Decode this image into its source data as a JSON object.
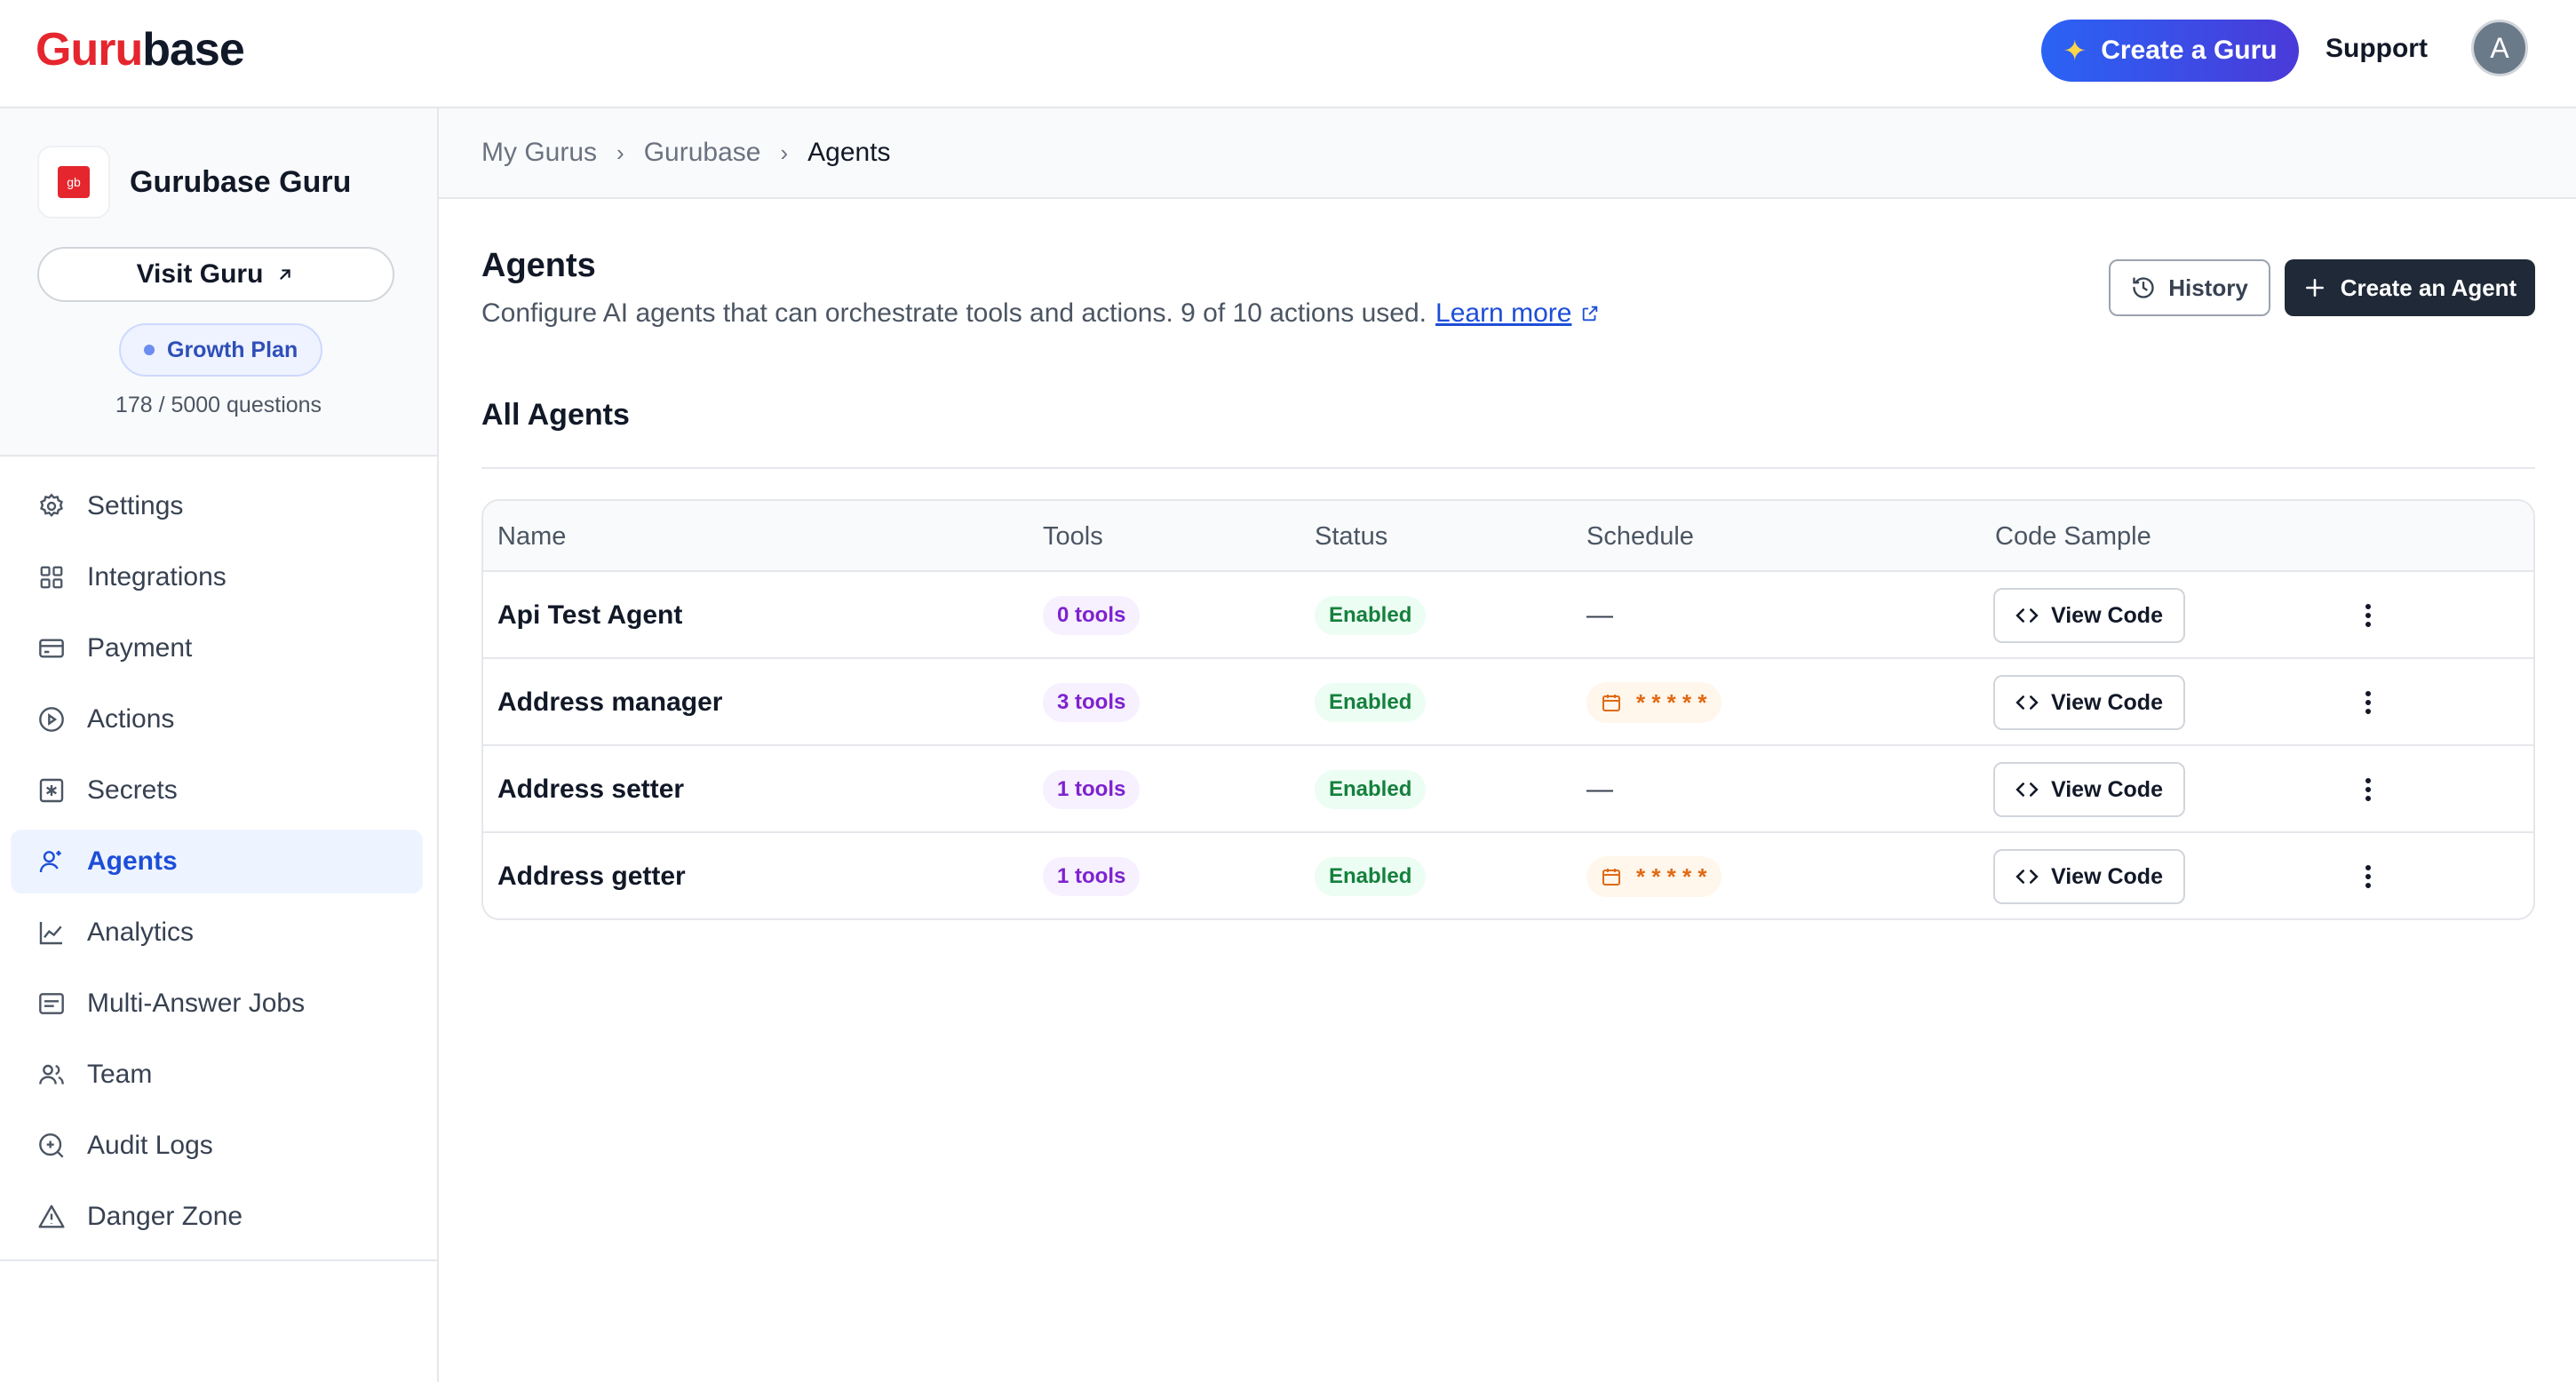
{
  "header": {
    "logo_part1": "Guru",
    "logo_part2": "base",
    "create_guru_label": "Create a Guru",
    "support_label": "Support",
    "avatar_initial": "A"
  },
  "sidebar": {
    "guru_logo_text": "gb",
    "guru_name": "Gurubase Guru",
    "visit_label": "Visit Guru",
    "plan_label": "Growth Plan",
    "quota_text": "178 / 5000 questions",
    "items": [
      {
        "label": "Settings",
        "icon": "gear-icon"
      },
      {
        "label": "Integrations",
        "icon": "grid-icon"
      },
      {
        "label": "Payment",
        "icon": "credit-card-icon"
      },
      {
        "label": "Actions",
        "icon": "play-circle-icon"
      },
      {
        "label": "Secrets",
        "icon": "asterisk-square-icon"
      },
      {
        "label": "Agents",
        "icon": "user-sparkle-icon",
        "active": true
      },
      {
        "label": "Analytics",
        "icon": "line-chart-icon"
      },
      {
        "label": "Multi-Answer Jobs",
        "icon": "list-box-icon"
      },
      {
        "label": "Team",
        "icon": "users-icon"
      },
      {
        "label": "Audit Logs",
        "icon": "search-log-icon"
      },
      {
        "label": "Danger Zone",
        "icon": "warning-icon"
      }
    ]
  },
  "breadcrumb": [
    "My Gurus",
    "Gurubase",
    "Agents"
  ],
  "main": {
    "title": "Agents",
    "description": "Configure AI agents that can orchestrate tools and actions. 9 of 10 actions used.",
    "learn_more": "Learn more",
    "history_label": "History",
    "create_agent_label": "Create an Agent",
    "section_title": "All Agents"
  },
  "table": {
    "columns": [
      "Name",
      "Tools",
      "Status",
      "Schedule",
      "Code Sample"
    ],
    "view_code_label": "View Code",
    "rows": [
      {
        "name": "Api Test Agent",
        "tools": "0 tools",
        "status": "Enabled",
        "schedule": "—"
      },
      {
        "name": "Address manager",
        "tools": "3 tools",
        "status": "Enabled",
        "schedule": "* * * * *"
      },
      {
        "name": "Address setter",
        "tools": "1 tools",
        "status": "Enabled",
        "schedule": "—"
      },
      {
        "name": "Address getter",
        "tools": "1 tools",
        "status": "Enabled",
        "schedule": "* * * * *"
      }
    ]
  },
  "colors": {
    "brand_red": "#e5262e",
    "primary_blue": "#2a63f5",
    "dark_button": "#1f2937",
    "enabled_green": "#15803d",
    "tools_purple": "#7e22ce",
    "schedule_orange": "#e06a13"
  }
}
